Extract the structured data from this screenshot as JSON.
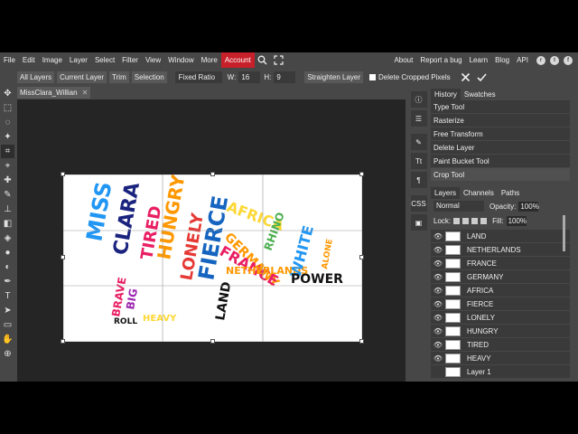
{
  "menu": {
    "items": [
      "File",
      "Edit",
      "Image",
      "Layer",
      "Select",
      "Filter",
      "View",
      "Window",
      "More",
      "Account"
    ],
    "right_items": [
      "About",
      "Report a bug",
      "Learn",
      "Blog",
      "API"
    ]
  },
  "options": {
    "buttons": [
      "All Layers",
      "Current Layer",
      "Trim",
      "Selection"
    ],
    "ratio_select": "Fixed Ratio",
    "w_label": "W:",
    "w_value": "16",
    "h_label": "H:",
    "h_value": "9",
    "straighten_label": "Straighten Layer",
    "delete_cropped_label": "Delete Cropped Pixels"
  },
  "document": {
    "tab_title": "MissClara_Willian"
  },
  "history": {
    "tabs": [
      "History",
      "Swatches"
    ],
    "items": [
      "Type Tool",
      "Rasterize",
      "Free Transform",
      "Delete Layer",
      "Paint Bucket Tool",
      "Crop Tool"
    ]
  },
  "layers": {
    "tabs": [
      "Layers",
      "Channels",
      "Paths"
    ],
    "blend_mode": "Normal",
    "opacity_label": "Opacity:",
    "opacity_value": "100%",
    "lock_label": "Lock:",
    "fill_label": "Fill:",
    "fill_value": "100%",
    "items": [
      "LAND",
      "NETHERLANDS",
      "FRANCE",
      "GERMANY",
      "AFRICA",
      "FIERCE",
      "LONELY",
      "HUNGRY",
      "TIRED",
      "HEAVY",
      "Layer 1"
    ]
  },
  "side_labels": {
    "css": "CSS"
  },
  "canvas_words": [
    {
      "text": "MISS",
      "color": "#2196f3"
    },
    {
      "text": "CLARA",
      "color": "#1a237e"
    },
    {
      "text": "TIRED",
      "color": "#e91e63"
    },
    {
      "text": "HUNGRY",
      "color": "#ff9800"
    },
    {
      "text": "LONELY",
      "color": "#e53935"
    },
    {
      "text": "FIERCE",
      "color": "#1565c0"
    },
    {
      "text": "AFRICA",
      "color": "#fdd835"
    },
    {
      "text": "GERMANY",
      "color": "#ff9800"
    },
    {
      "text": "FRANCE",
      "color": "#e91e63"
    },
    {
      "text": "NETHERLANDS",
      "color": "#ff9800"
    },
    {
      "text": "RHINO",
      "color": "#4caf50"
    },
    {
      "text": "WHITE",
      "color": "#2196f3"
    },
    {
      "text": "POWER",
      "color": "#111111"
    },
    {
      "text": "ALONE",
      "color": "#ff9800"
    },
    {
      "text": "BRAVE",
      "color": "#e91e63"
    },
    {
      "text": "BIG",
      "color": "#9c27b0"
    },
    {
      "text": "HEAVY",
      "color": "#fdd835"
    },
    {
      "text": "ROLL",
      "color": "#111111"
    },
    {
      "text": "LAND",
      "color": "#111111"
    }
  ]
}
